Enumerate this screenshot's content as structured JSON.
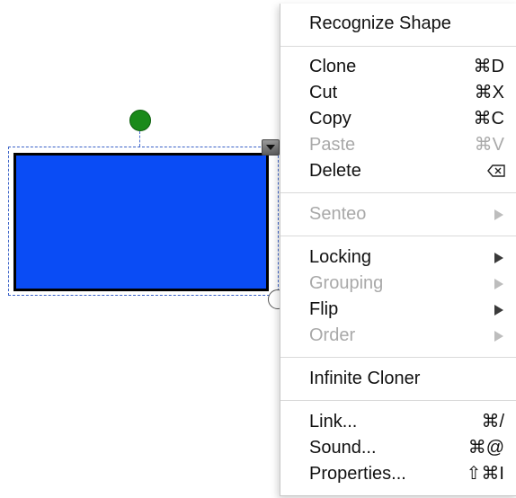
{
  "menu": {
    "items": [
      {
        "label": "Recognize Shape",
        "shortcut": "",
        "enabled": true,
        "submenu": false
      },
      {
        "label": "Clone",
        "shortcut": "⌘D",
        "enabled": true,
        "submenu": false
      },
      {
        "label": "Cut",
        "shortcut": "⌘X",
        "enabled": true,
        "submenu": false
      },
      {
        "label": "Copy",
        "shortcut": "⌘C",
        "enabled": true,
        "submenu": false
      },
      {
        "label": "Paste",
        "shortcut": "⌘V",
        "enabled": false,
        "submenu": false
      },
      {
        "label": "Delete",
        "shortcut": "",
        "shortcut_icon": "delete-key-icon",
        "enabled": true,
        "submenu": false
      },
      {
        "label": "Senteo",
        "shortcut": "",
        "enabled": false,
        "submenu": true
      },
      {
        "label": "Locking",
        "shortcut": "",
        "enabled": true,
        "submenu": true
      },
      {
        "label": "Grouping",
        "shortcut": "",
        "enabled": false,
        "submenu": true
      },
      {
        "label": "Flip",
        "shortcut": "",
        "enabled": true,
        "submenu": true
      },
      {
        "label": "Order",
        "shortcut": "",
        "enabled": false,
        "submenu": true
      },
      {
        "label": "Infinite Cloner",
        "shortcut": "",
        "enabled": true,
        "submenu": false
      },
      {
        "label": "Link...",
        "shortcut": "⌘/",
        "enabled": true,
        "submenu": false
      },
      {
        "label": "Sound...",
        "shortcut": "⌘@",
        "enabled": true,
        "submenu": false
      },
      {
        "label": "Properties...",
        "shortcut": "⇧⌘I",
        "enabled": true,
        "submenu": false
      }
    ]
  },
  "canvas": {
    "shape": {
      "type": "rectangle",
      "fill": "#0a4cf5",
      "stroke": "#000000"
    },
    "rotate_handle_color": "#1a8a1a",
    "selection_color": "#3a62c8"
  }
}
